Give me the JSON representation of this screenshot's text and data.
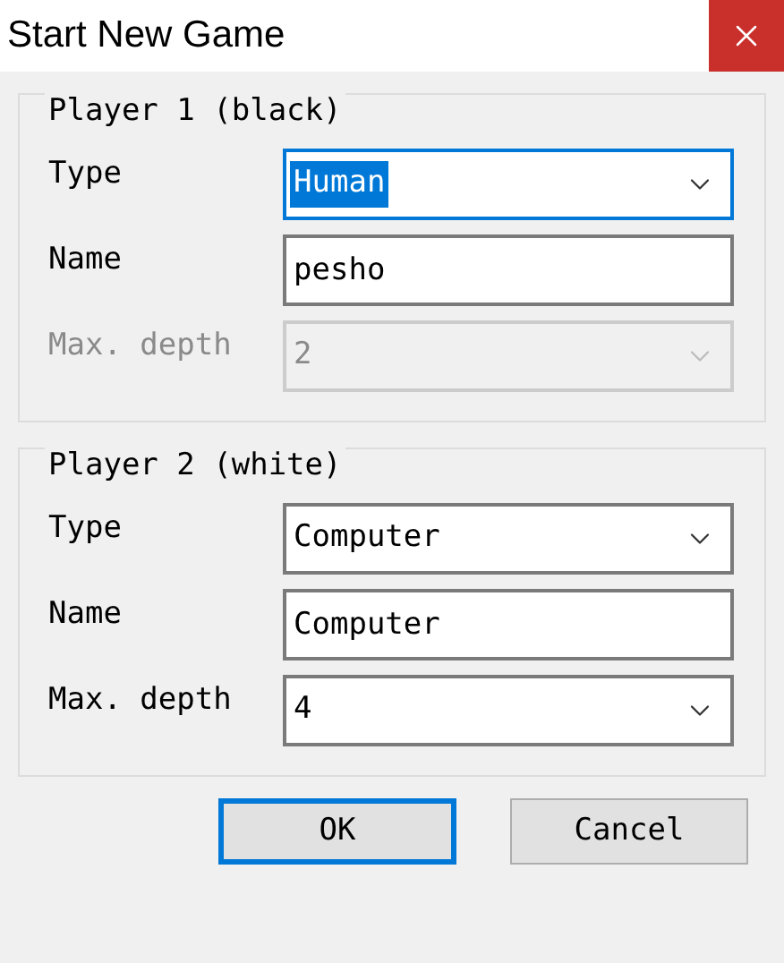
{
  "window": {
    "title": "Start New Game"
  },
  "groups": [
    {
      "title": "Player 1 (black)",
      "fields": [
        {
          "kind": "select",
          "label": "Type",
          "value": "Human",
          "focused": true,
          "disabled": false
        },
        {
          "kind": "text",
          "label": "Name",
          "value": "pesho",
          "focused": false,
          "disabled": false
        },
        {
          "kind": "select",
          "label": "Max. depth",
          "value": "2",
          "focused": false,
          "disabled": true
        }
      ]
    },
    {
      "title": "Player 2 (white)",
      "fields": [
        {
          "kind": "select",
          "label": "Type",
          "value": "Computer",
          "focused": false,
          "disabled": false
        },
        {
          "kind": "text",
          "label": "Name",
          "value": "Computer",
          "focused": false,
          "disabled": false
        },
        {
          "kind": "select",
          "label": "Max. depth",
          "value": "4",
          "focused": false,
          "disabled": false
        }
      ]
    }
  ],
  "buttons": [
    {
      "label": "OK",
      "default": true
    },
    {
      "label": "Cancel",
      "default": false
    }
  ]
}
